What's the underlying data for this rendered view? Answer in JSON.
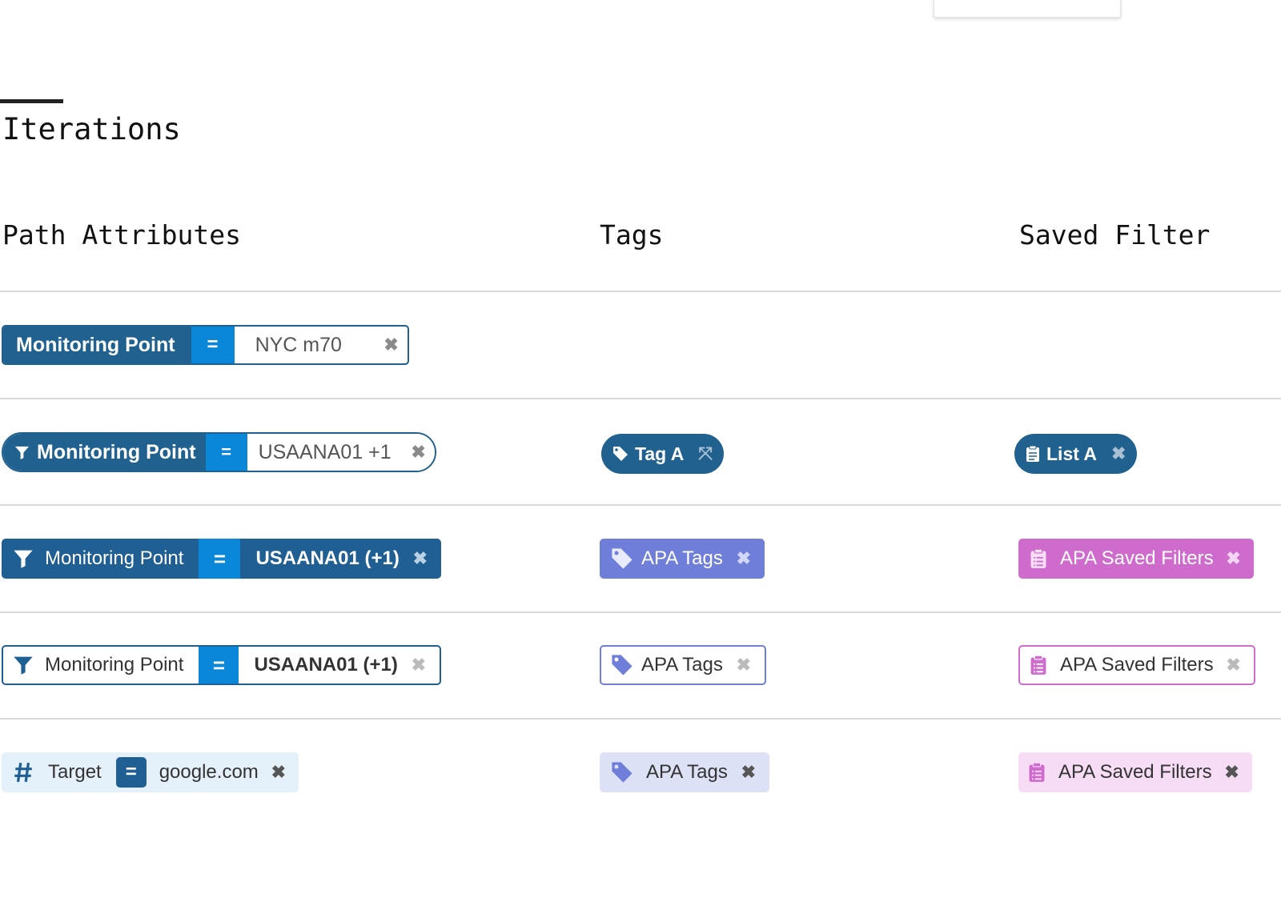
{
  "page": {
    "title": "Iterations",
    "columns": [
      "Path Attributes",
      "Tags",
      "Saved Filter"
    ]
  },
  "colors": {
    "path_dark": "#20618f",
    "operator_blue": "#0a87d8",
    "tags_purple": "#6f7ed8",
    "saved_pink": "#cf6bcc",
    "path_light_bg": "#e4f0fa",
    "tags_light_bg": "#dde1f6",
    "saved_light_bg": "#f6ddf5"
  },
  "rows": [
    {
      "path": {
        "icon": null,
        "label": "Monitoring Point",
        "operator": "=",
        "value": "NYC m70"
      }
    },
    {
      "path": {
        "icon": "filter-icon",
        "label": "Monitoring Point",
        "operator": "=",
        "value": "USAANA01 +1"
      },
      "tag": {
        "icon": "tag-icon",
        "label": "Tag A",
        "close_icon": "expand-close-icon"
      },
      "saved": {
        "icon": "clipboard-icon",
        "label": "List A"
      }
    },
    {
      "path": {
        "icon": "filter-icon",
        "label": "Monitoring Point",
        "operator": "=",
        "value": "USAANA01 (+1)"
      },
      "tag": {
        "icon": "tag-icon",
        "label": "APA Tags"
      },
      "saved": {
        "icon": "clipboard-list-icon",
        "label": "APA Saved Filters"
      }
    },
    {
      "path": {
        "icon": "filter-icon",
        "label": "Monitoring Point",
        "operator": "=",
        "value": "USAANA01 (+1)"
      },
      "tag": {
        "icon": "tag-icon",
        "label": "APA Tags"
      },
      "saved": {
        "icon": "clipboard-list-icon",
        "label": "APA Saved Filters"
      }
    },
    {
      "path": {
        "icon": "hash-icon",
        "label": "Target",
        "operator": "=",
        "value": "google.com"
      },
      "tag": {
        "icon": "tag-icon",
        "label": "APA Tags"
      },
      "saved": {
        "icon": "clipboard-list-icon",
        "label": "APA Saved Filters"
      }
    }
  ],
  "remove_glyph": "✖",
  "expand_glyph": "⤧"
}
